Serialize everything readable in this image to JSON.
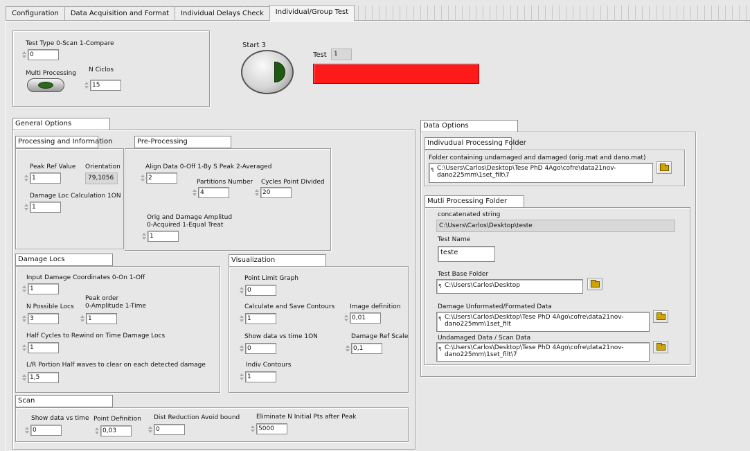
{
  "tabs": [
    "Configuration",
    "Data Acquisition and Format",
    "Individual Delays Check",
    "Individual/Group Test"
  ],
  "top": {
    "test_type_label": "Test Type 0-Scan 1-Compare",
    "test_type_value": "0",
    "multi_processing_label": "Multi Processing",
    "n_ciclos_label": "N Ciclos",
    "n_ciclos_value": "15",
    "start_label": "Start 3",
    "test_label": "Test",
    "test_value": "1",
    "test_indicator_color": "#ff1a1a"
  },
  "general": {
    "title": "General Options",
    "processing": {
      "title": "Processing and Information",
      "peak_ref_label": "Peak Ref Value",
      "peak_ref_value": "1",
      "orientation_label": "Orientation",
      "orientation_value": "79,1056",
      "damage_loc_label": "Damage Loc  Calculation 1ON",
      "damage_loc_value": "1"
    },
    "preprocessing": {
      "title": "Pre-Processing",
      "align_label": "Align Data 0-Off 1-By S Peak 2-Averaged",
      "align_value": "2",
      "partitions_label": "Partitions Number",
      "partitions_value": "4",
      "cycles_label": "Cycles Point Divided",
      "cycles_value": "20",
      "orig_label1": "Orig and Damage Amplitud",
      "orig_label2": "0-Acquired 1-Equal Treat",
      "orig_value": "1"
    },
    "damage_locs": {
      "title": "Damage Locs",
      "input_coords_label": "Input Damage Coordinates 0-On 1-Off",
      "input_coords_value": "1",
      "n_possible_label": "N Possible Locs",
      "n_possible_value": "3",
      "peak_order_label1": "Peak order",
      "peak_order_label2": "0-Amplitude 1-Time",
      "peak_order_value": "1",
      "half_cycles_label": "Half Cycles to Rewind on Time Damage Locs",
      "half_cycles_value": "1",
      "lr_portion_label": "L/R Portion Half waves to clear on each detected damage",
      "lr_portion_value": "1,5"
    },
    "visualization": {
      "title": "Visualization",
      "point_limit_label": "Point Limit Graph",
      "point_limit_value": "0",
      "calc_contours_label": "Calculate and Save  Contours",
      "calc_contours_value": "1",
      "image_def_label": "Image definition",
      "image_def_value": "0,01",
      "show_data_label": "Show data vs time 1ON",
      "show_data_value": "0",
      "damage_ref_label": "Damage Ref Scale",
      "damage_ref_value": "0,1",
      "indiv_contours_label": "Indiv Contours",
      "indiv_contours_value": "1"
    },
    "scan": {
      "title": "Scan",
      "show_data_label": "Show data vs time",
      "show_data_value": "0",
      "point_def_label": "Point Definition",
      "point_def_value": "0,03",
      "dist_reduction_label": "Dist Reduction Avoid bound",
      "dist_reduction_value": "0",
      "eliminate_label": "Eliminate N Initial Pts after Peak",
      "eliminate_value": "5000"
    }
  },
  "data_options": {
    "title": "Data Options",
    "indiv_folder_title": "Indivudual Processing Folder",
    "folder_label": "Folder containing undamaged and damaged (orig.mat and dano.mat)",
    "folder_value": "C:\\Users\\Carlos\\Desktop\\Tese PhD 4Ago\\cofre\\data21nov-dano225mm\\1set_filt\\7",
    "multi_folder_title": "Mutli Processing Folder",
    "concat_label": "concatenated string",
    "concat_value": "C:\\Users\\Carlos\\Desktop\\teste",
    "test_name_label": "Test Name",
    "test_name_value": "teste",
    "base_folder_label": "Test Base Folder",
    "base_folder_value": "C:\\Users\\Carlos\\Desktop",
    "damage_data_label": "Damage Unformated/Formated Data",
    "damage_data_value": "C:\\Users\\Carlos\\Desktop\\Tese PhD 4Ago\\cofre\\data21nov-dano225mm\\1set_filt",
    "undamaged_label": "Undamaged Data / Scan Data",
    "undamaged_value": "C:\\Users\\Carlos\\Desktop\\Tese PhD 4Ago\\cofre\\data21nov-dano225mm\\1set_filt\\7"
  }
}
